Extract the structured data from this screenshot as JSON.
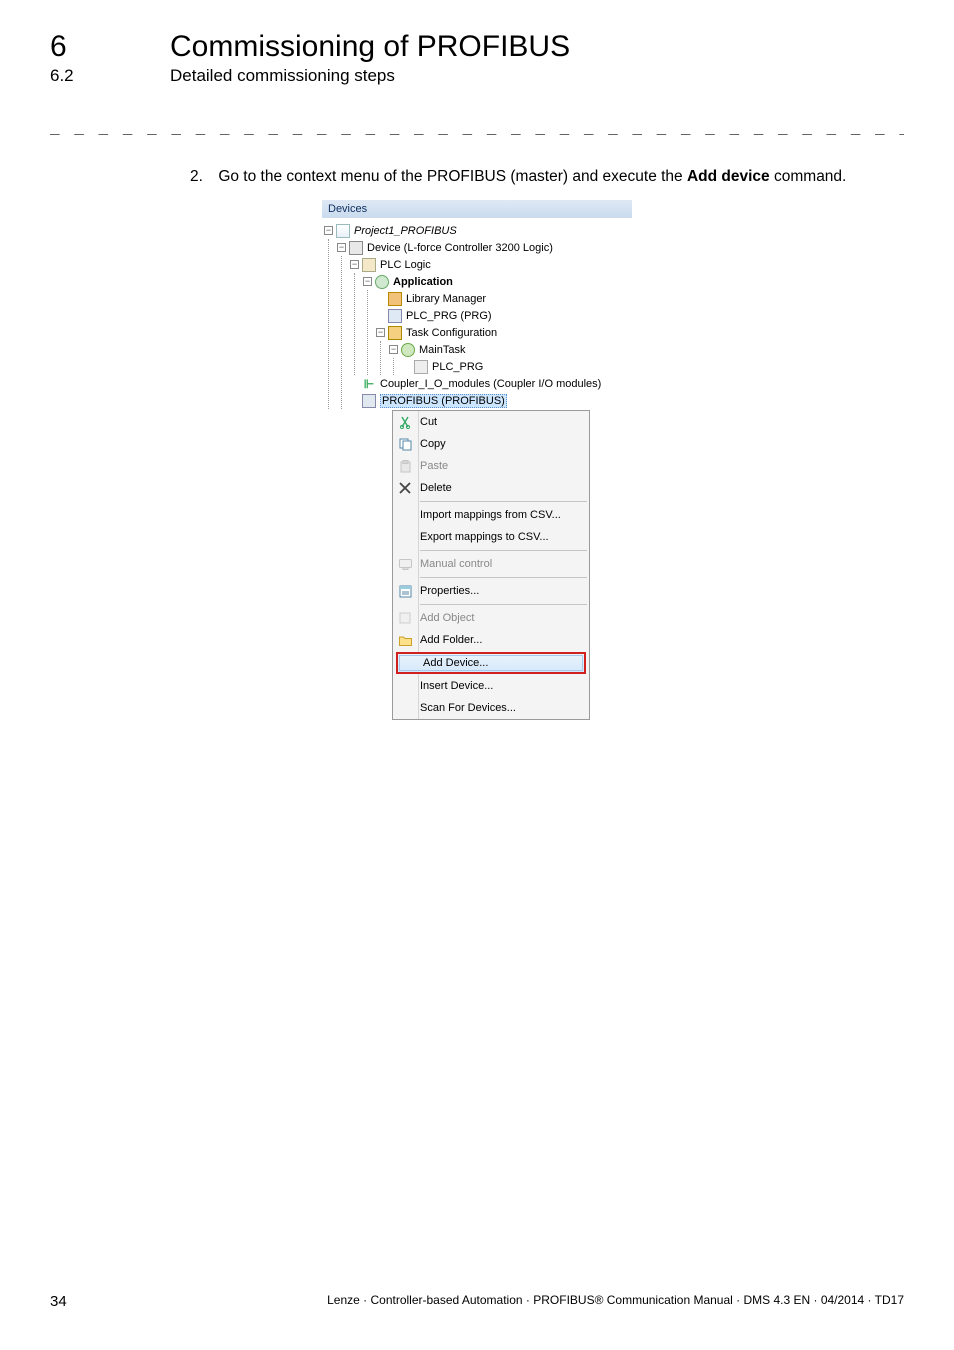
{
  "chapter": {
    "num": "6",
    "title": "Commissioning of PROFIBUS"
  },
  "section": {
    "num": "6.2",
    "title": "Detailed commissioning steps"
  },
  "dashes": "_ _ _ _ _ _ _ _ _ _ _ _ _ _ _ _ _ _ _ _ _ _ _ _ _ _ _ _ _ _ _ _ _ _ _ _ _ _ _ _ _ _ _ _ _ _ _ _ _ _ _ _ _ _ _ _ _ _ _ _ _ _ _ _",
  "step": {
    "num": "2.",
    "pre": "Go to the context menu of the PROFIBUS (master) and execute the ",
    "bold": "Add device",
    "post": " command."
  },
  "panel_title": "Devices",
  "tree": {
    "project": "Project1_PROFIBUS",
    "device": "Device (L-force Controller 3200 Logic)",
    "plc_logic": "PLC Logic",
    "application": "Application",
    "library_manager": "Library Manager",
    "plc_prg": "PLC_PRG (PRG)",
    "task_config": "Task Configuration",
    "main_task": "MainTask",
    "plc_prg_call": "PLC_PRG",
    "coupler": "Coupler_I_O_modules (Coupler I/O modules)",
    "profibus": "PROFIBUS (PROFIBUS)"
  },
  "menu": {
    "cut": "Cut",
    "copy": "Copy",
    "paste": "Paste",
    "delete": "Delete",
    "import_csv": "Import mappings from CSV...",
    "export_csv": "Export mappings to CSV...",
    "manual_control": "Manual control",
    "properties": "Properties...",
    "add_object": "Add Object",
    "add_folder": "Add Folder...",
    "add_device": "Add Device...",
    "insert_device": "Insert Device...",
    "scan": "Scan For Devices..."
  },
  "footer": {
    "page": "34",
    "attribution": "Lenze · Controller-based Automation · PROFIBUS® Communication Manual · DMS 4.3 EN · 04/2014 · TD17"
  }
}
